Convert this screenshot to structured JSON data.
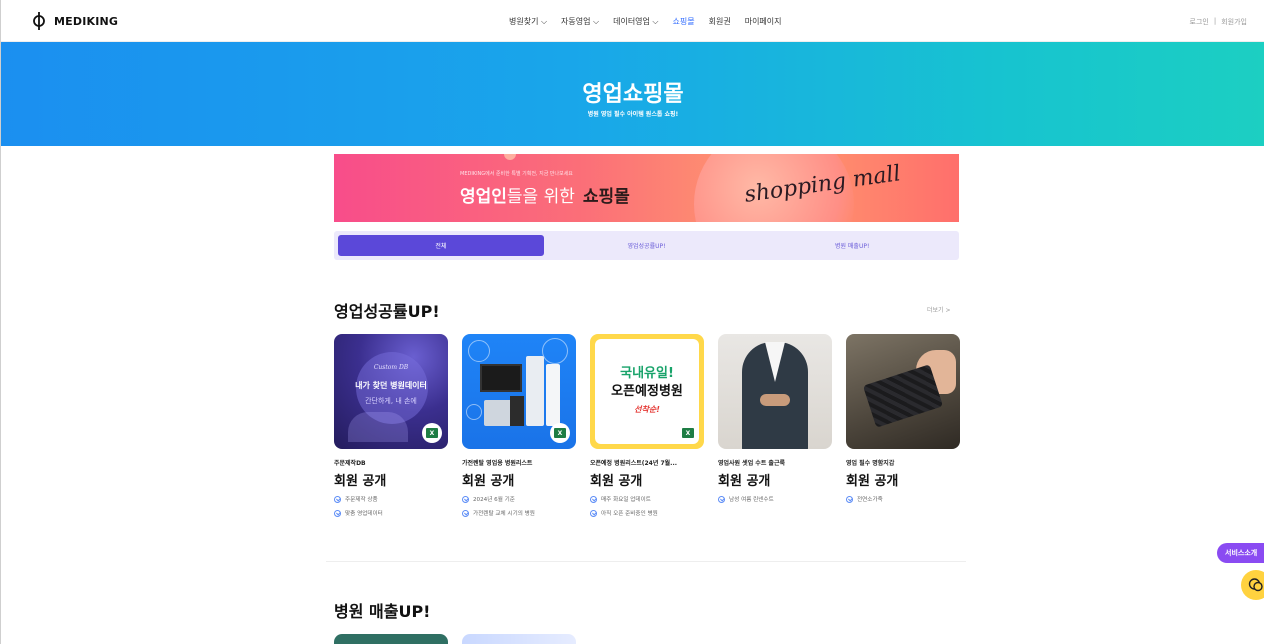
{
  "brand": {
    "name": "MEDIKING"
  },
  "nav": [
    {
      "label": "병원찾기 ⌵"
    },
    {
      "label": "자동영업 ⌵"
    },
    {
      "label": "데이터영업 ⌵"
    },
    {
      "label": "쇼핑몰"
    },
    {
      "label": "회원권"
    },
    {
      "label": "마이페이지"
    }
  ],
  "util": {
    "login": "로그인",
    "sep": "|",
    "signup": "회원가입"
  },
  "hero": {
    "title": "영업쇼핑몰",
    "subtitle": "병원 영업 필수 아이템 원스톱 쇼핑!"
  },
  "banner": {
    "small": "MEDIKING에서 준비한 특별 기획전, 지금 만나보세요",
    "big_bold": "영업인",
    "big_regular": "들을 위한",
    "big_dark": "쇼핑몰",
    "script": "shopping mall"
  },
  "tabs": [
    {
      "label": "전체"
    },
    {
      "label": "영업성공률UP!"
    },
    {
      "label": "병원 매출UP!"
    }
  ],
  "section1": {
    "title": "영업성공률UP!",
    "more": "더보기 >",
    "cards": [
      {
        "subtitle": "주문제작DB",
        "price": "회원 공개",
        "features": [
          "주문제작 상품",
          "맞춤 영업데이터"
        ],
        "thumb": {
          "l1": "Custom DB",
          "l2": "내가 찾던 병원데이터",
          "l3": "간단하게, 내 손에"
        }
      },
      {
        "subtitle": "가전렌탈 영업용 병원리스트",
        "price": "회원 공개",
        "features": [
          "2024년 6월 기준",
          "가전렌탈 교체 시기의 병원"
        ]
      },
      {
        "subtitle": "오픈예정 병원리스트(24년 7월...",
        "price": "회원 공개",
        "features": [
          "매주 화요일 업데이트",
          "아직 오픈 준비중인 병원"
        ],
        "thumb": {
          "y1": "국내유일!",
          "y2": "오픈예정병원",
          "y3": "선착순!"
        }
      },
      {
        "subtitle": "영업사원 셋업 수트 출근룩",
        "price": "회원 공개",
        "features": [
          "남성 여름 린넨수트"
        ]
      },
      {
        "subtitle": "영업 필수 명함지갑",
        "price": "회원 공개",
        "features": [
          "전연소가죽"
        ]
      }
    ]
  },
  "section2": {
    "title": "병원 매출UP!"
  },
  "floating": {
    "service": "서비스소개"
  },
  "colors": {
    "accent": "#5b48d9",
    "heroStart": "#1b8ff0",
    "heroEnd": "#1ccfc2",
    "service": "#8a4bf2",
    "chat": "#ffd23f"
  }
}
